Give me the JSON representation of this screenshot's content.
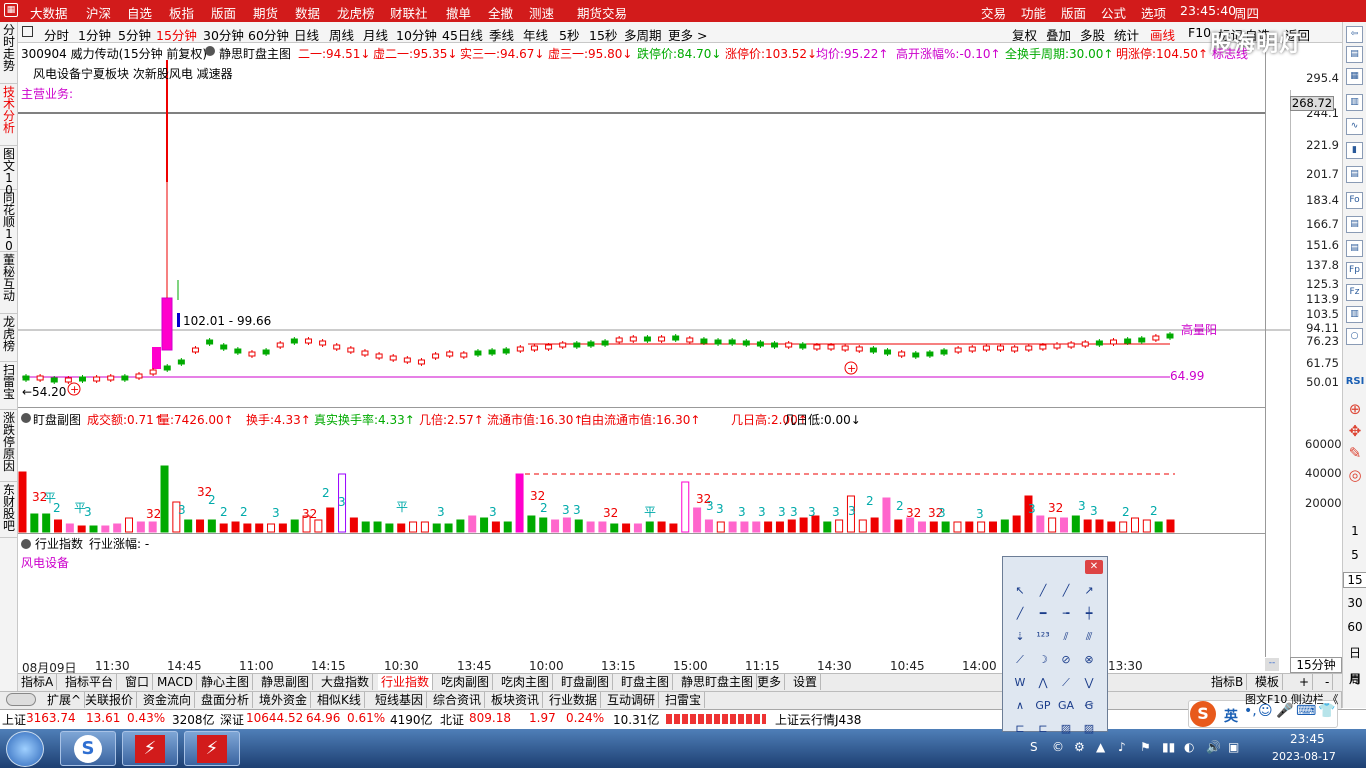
{
  "top_menu": {
    "left": [
      "大数据",
      "沪深",
      "自选",
      "板指",
      "版面",
      "期货",
      "数据",
      "龙虎榜",
      "财联社",
      "撤单",
      "全撤",
      "测速",
      "期货交易"
    ],
    "right": [
      "交易",
      "功能",
      "版面",
      "公式",
      "选项"
    ],
    "clock": "23:45:40",
    "weekday": "周四",
    "logo": "股海明灯"
  },
  "left_nav": [
    "分时走势",
    "技术分析",
    "图文10",
    "同花顺10",
    "董秘互动",
    "龙虎榜",
    "扫雷宝",
    "涨跌停原因",
    "东财股吧"
  ],
  "timeframes": [
    "分时",
    "1分钟",
    "5分钟",
    "15分钟",
    "30分钟",
    "60分钟",
    "日线",
    "周线",
    "月线",
    "10分钟",
    "45日线",
    "季线",
    "年线",
    "5秒",
    "15秒",
    "多周期",
    "更多 >"
  ],
  "active_timeframe": "15分钟",
  "toolbar_right": [
    "复权",
    "叠加",
    "多股",
    "统计",
    "画线",
    "F10",
    "标记",
    "自选",
    "返回"
  ],
  "stock": {
    "title": "300904 威力传动(15分钟 前复权)",
    "indicator": "静思盯盘主图",
    "sector": "风电设备宁夏板块 次新股风电 减速器",
    "business": "主营业务:"
  },
  "main_info": [
    {
      "label": "二一:",
      "value": "94.51",
      "arrow": "↓",
      "color": "#e00"
    },
    {
      "label": "虚二一:",
      "value": "95.35",
      "arrow": "↓",
      "color": "#e00"
    },
    {
      "label": "实三一:",
      "value": "94.67",
      "arrow": "↓",
      "color": "#e00"
    },
    {
      "label": "虚三一:",
      "value": "95.80",
      "arrow": "↓",
      "color": "#e00"
    },
    {
      "label": "跌停价:",
      "value": "84.70",
      "arrow": "↓",
      "color": "#0a0"
    },
    {
      "label": "涨停价:",
      "value": "103.52",
      "arrow": "↓",
      "color": "#e00"
    },
    {
      "label": "均价:",
      "value": "95.22",
      "arrow": "↑",
      "color": "#c0c"
    },
    {
      "label": "高开涨幅%:",
      "value": "-0.10",
      "arrow": "↑",
      "color": "#c0c"
    },
    {
      "label": "全换手周期:",
      "value": "30.00",
      "arrow": "↑",
      "color": "#0a0"
    },
    {
      "label": "明涨停:",
      "value": "104.50",
      "arrow": "↑",
      "color": "#e00"
    },
    {
      "label": "标志线",
      "value": "",
      "arrow": "",
      "color": "#c0c"
    }
  ],
  "price_axis": [
    "295.4",
    "244.1",
    "221.9",
    "201.7",
    "183.4",
    "166.7",
    "151.6",
    "137.8",
    "125.3",
    "113.9",
    "103.5",
    "94.11",
    "76.23",
    "61.75",
    "50.01"
  ],
  "crosshair_price": "268.72",
  "annotations": {
    "range_label": "102.01 - 99.66",
    "low_label": "←54.20",
    "line_label": "64.99",
    "high_label": "高量阳"
  },
  "vol_info": [
    {
      "label": "盯盘副图",
      "value": "",
      "color": "#000"
    },
    {
      "label": "成交额:",
      "value": "0.71",
      "arrow": "↑",
      "color": "#e00"
    },
    {
      "label": "量:",
      "value": "7426.00",
      "arrow": "↑",
      "color": "#e00"
    },
    {
      "label": "换手:",
      "value": "4.33",
      "arrow": "↑",
      "color": "#e00"
    },
    {
      "label": "真实换手率:",
      "value": "4.33",
      "arrow": "↑",
      "color": "#0a0"
    },
    {
      "label": "几倍:",
      "value": "2.57",
      "arrow": "↑",
      "color": "#e00"
    },
    {
      "label": "流通市值:",
      "value": "16.30",
      "arrow": "↑",
      "color": "#e00"
    },
    {
      "label": "自由流通市值:",
      "value": "16.30",
      "arrow": "↑",
      "color": "#e00"
    },
    {
      "label": "几日高:",
      "value": "2.00",
      "arrow": "↑",
      "color": "#e00"
    },
    {
      "label": "几日低:",
      "value": "0.00",
      "arrow": "↓",
      "color": "#000"
    }
  ],
  "vol_axis": [
    "60000",
    "40000",
    "20000"
  ],
  "vol_marks": [
    {
      "t": "32",
      "c": "#e00"
    },
    {
      "t": "平",
      "c": "#0aa"
    },
    {
      "t": "2",
      "c": "#0aa"
    },
    {
      "t": "平",
      "c": "#0aa"
    },
    {
      "t": "3",
      "c": "#0aa"
    },
    {
      "t": "32",
      "c": "#e00"
    },
    {
      "t": "3",
      "c": "#0aa"
    },
    {
      "t": "32",
      "c": "#e00"
    },
    {
      "t": "2",
      "c": "#0aa"
    },
    {
      "t": "2",
      "c": "#0aa"
    },
    {
      "t": "2",
      "c": "#0aa"
    },
    {
      "t": "3",
      "c": "#0aa"
    },
    {
      "t": "32",
      "c": "#e00"
    },
    {
      "t": "2",
      "c": "#0aa"
    },
    {
      "t": "3",
      "c": "#0aa"
    },
    {
      "t": "平",
      "c": "#0aa"
    },
    {
      "t": "3",
      "c": "#0aa"
    },
    {
      "t": "3",
      "c": "#0aa"
    },
    {
      "t": "32",
      "c": "#e00"
    },
    {
      "t": "2",
      "c": "#0aa"
    },
    {
      "t": "3",
      "c": "#0aa"
    },
    {
      "t": "3",
      "c": "#0aa"
    },
    {
      "t": "32",
      "c": "#e00"
    },
    {
      "t": "平",
      "c": "#0aa"
    },
    {
      "t": "32",
      "c": "#e00"
    },
    {
      "t": "3",
      "c": "#0aa"
    },
    {
      "t": "3",
      "c": "#0aa"
    },
    {
      "t": "3",
      "c": "#0aa"
    },
    {
      "t": "3",
      "c": "#0aa"
    },
    {
      "t": "3",
      "c": "#0aa"
    },
    {
      "t": "3",
      "c": "#0aa"
    },
    {
      "t": "3",
      "c": "#0aa"
    },
    {
      "t": "3",
      "c": "#0aa"
    },
    {
      "t": "3",
      "c": "#0aa"
    },
    {
      "t": "2",
      "c": "#0aa"
    },
    {
      "t": "2",
      "c": "#0aa"
    },
    {
      "t": "32",
      "c": "#e00"
    },
    {
      "t": "32",
      "c": "#e00"
    },
    {
      "t": "3",
      "c": "#0aa"
    },
    {
      "t": "3",
      "c": "#0aa"
    },
    {
      "t": "3",
      "c": "#0aa"
    },
    {
      "t": "32",
      "c": "#e00"
    },
    {
      "t": "3",
      "c": "#0aa"
    },
    {
      "t": "3",
      "c": "#0aa"
    },
    {
      "t": "2",
      "c": "#0aa"
    },
    {
      "t": "2",
      "c": "#0aa"
    }
  ],
  "industry": {
    "label": "行业指数",
    "change_label": "行业涨幅: -",
    "name": "风电设备"
  },
  "x_axis": [
    "08月09日",
    "11:30",
    "14:45",
    "11:00",
    "14:15",
    "10:30",
    "13:45",
    "10:00",
    "13:15",
    "15:00",
    "11:15",
    "14:30",
    "10:45",
    "14:00",
    "13:30"
  ],
  "period_select": "15分钟",
  "bottom_tabs": [
    "指标A",
    "指标平台",
    "窗口",
    "MACD",
    "静心主图",
    "静思副图",
    "大盘指数",
    "行业指数",
    "吃肉副图",
    "吃肉主图",
    "盯盘副图",
    "盯盘主图",
    "静思盯盘主图",
    "更多",
    "设置"
  ],
  "active_bottom_tab": "行业指数",
  "right_tabs": [
    "指标B",
    "模板",
    "+",
    "-"
  ],
  "bottom_tabs2": [
    "扩展^",
    "关联报价",
    "资金流向",
    "盘面分析",
    "境外资金",
    "相似K线",
    "短线基因",
    "综合资讯",
    "板块资讯",
    "行业数据",
    "互动调研",
    "扫雷宝"
  ],
  "bottom_tabs2_right": "图文F10 侧边栏 《",
  "status": {
    "sh_label": "上证",
    "sh_val": "3163.74",
    "sh_chg": "13.61",
    "sh_pct": "0.43%",
    "sh_amt": "3208亿",
    "sz_label": "深证",
    "sz_val": "10644.52",
    "sz_chg": "64.96",
    "sz_pct": "0.61%",
    "sz_amt": "4190亿",
    "nb_label": "北证",
    "nb_val": "809.18",
    "nb_chg": "1.97",
    "nb_pct": "0.24%",
    "nb_amt": "10.31亿",
    "cloud": "上证云行情J438"
  },
  "ime": {
    "mode": "英"
  },
  "right_tools": [
    "RSI",
    "1",
    "5",
    "15",
    "30",
    "60",
    "日",
    "周",
    "月"
  ],
  "taskbar": {
    "time": "23:45",
    "date": "2023-08-17"
  }
}
